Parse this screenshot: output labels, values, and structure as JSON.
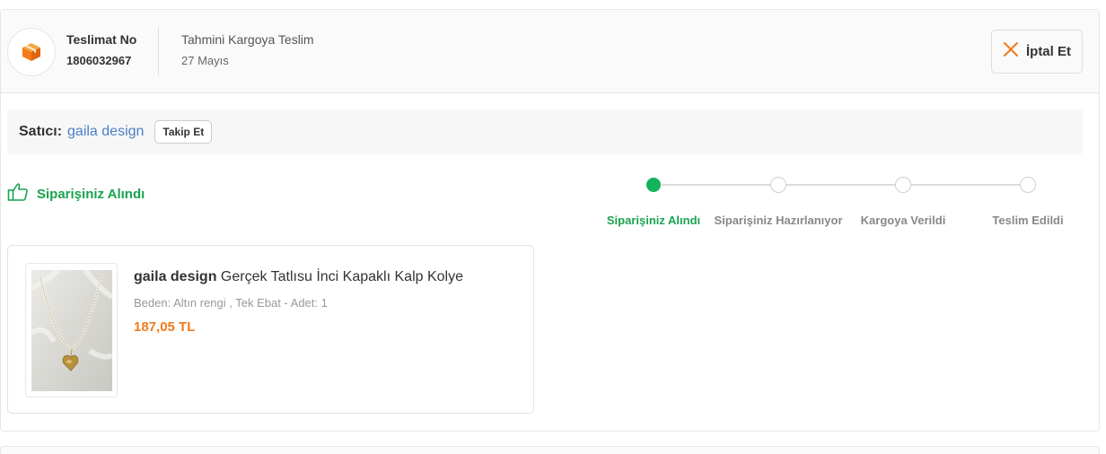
{
  "header": {
    "delivery_no_label": "Teslimat No",
    "delivery_no": "1806032967",
    "estimate_label": "Tahmini Kargoya Teslim",
    "estimate_value": "27 Mayıs",
    "cancel_label": "İptal Et",
    "package_icon": "package-icon",
    "cancel_icon": "close-icon"
  },
  "seller": {
    "label": "Satıcı:",
    "name": "gaila design",
    "follow_label": "Takip Et"
  },
  "status": {
    "icon": "thumbs-up-icon",
    "text": "Siparişiniz Alındı",
    "color": "#1aa350"
  },
  "tracker": {
    "active_index": 0,
    "active_color": "#11b35b",
    "steps": [
      {
        "label": "Siparişiniz Alındı"
      },
      {
        "label": "Siparişiniz Hazırlanıyor"
      },
      {
        "label": "Kargoya Verildi"
      },
      {
        "label": "Teslim Edildi"
      }
    ]
  },
  "product": {
    "brand": "gaila design",
    "title": "Gerçek Tatlısu İnci Kapaklı Kalp Kolye",
    "attributes": "Beden: Altın rengi , Tek Ebat - Adet: 1",
    "price": "187,05 TL",
    "price_color": "#f27a1a"
  },
  "colors": {
    "accent_orange": "#f27a1a",
    "seller_link": "#4a7fc7"
  }
}
